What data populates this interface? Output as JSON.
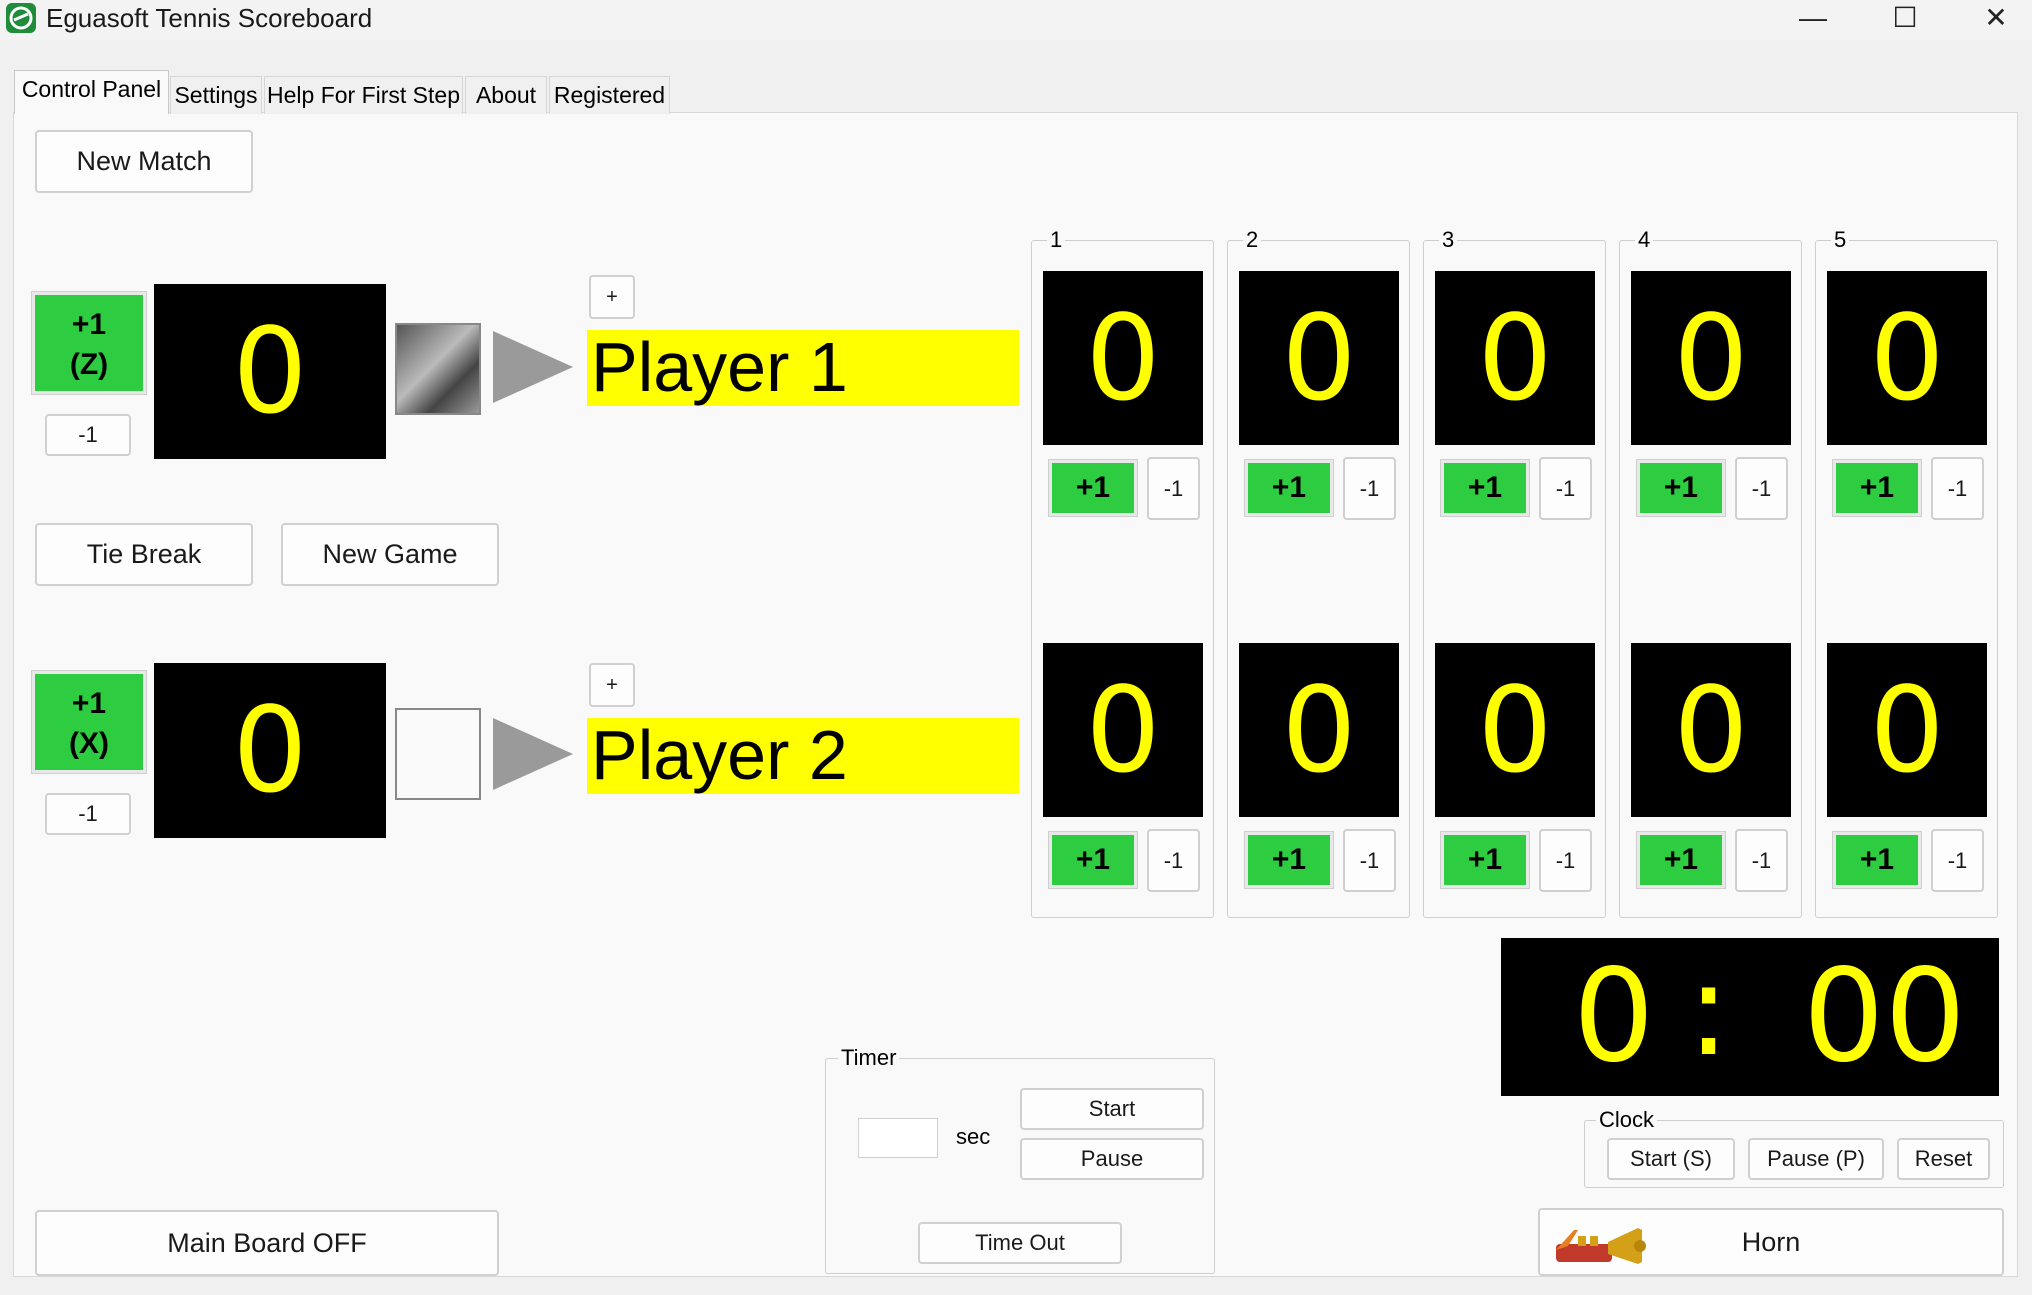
{
  "window": {
    "title": "Eguasoft Tennis Scoreboard",
    "minimize_glyph": "—",
    "maximize_glyph": "☐",
    "close_glyph": "✕"
  },
  "tabs": [
    "Control Panel",
    "Settings",
    "Help For First Step",
    "About",
    "Registered"
  ],
  "buttons": {
    "new_match": "New Match",
    "tie_break": "Tie Break",
    "new_game": "New Game",
    "main_board": "Main Board OFF",
    "horn": "Horn",
    "plus_small": "+"
  },
  "players": [
    {
      "name": "Player 1",
      "points": "0",
      "add_label": "+1",
      "key_label": "(Z)",
      "minus_label": "-1"
    },
    {
      "name": "Player 2",
      "points": "0",
      "add_label": "+1",
      "key_label": "(X)",
      "minus_label": "-1"
    }
  ],
  "sets": [
    {
      "label": "1",
      "p1": "0",
      "p2": "0"
    },
    {
      "label": "2",
      "p1": "0",
      "p2": "0"
    },
    {
      "label": "3",
      "p1": "0",
      "p2": "0"
    },
    {
      "label": "4",
      "p1": "0",
      "p2": "0"
    },
    {
      "label": "5",
      "p1": "0",
      "p2": "0"
    }
  ],
  "set_buttons": {
    "plus": "+1",
    "minus": "-1"
  },
  "timer": {
    "label": "Timer",
    "value": "",
    "unit": "sec",
    "start": "Start",
    "pause": "Pause",
    "timeout": "Time Out"
  },
  "clock": {
    "label": "Clock",
    "minutes": "0",
    "separator": ":",
    "seconds": "00",
    "start": "Start (S)",
    "pause": "Pause (P)",
    "reset": "Reset"
  },
  "colors": {
    "score_text": "#ffff00",
    "score_bg": "#000000",
    "name_bg": "#ffff00",
    "add_button": "#2ecc40"
  },
  "icons": {
    "app": "app-logo-icon",
    "horn": "trumpet-icon",
    "arrow": "arrow-right-icon"
  }
}
